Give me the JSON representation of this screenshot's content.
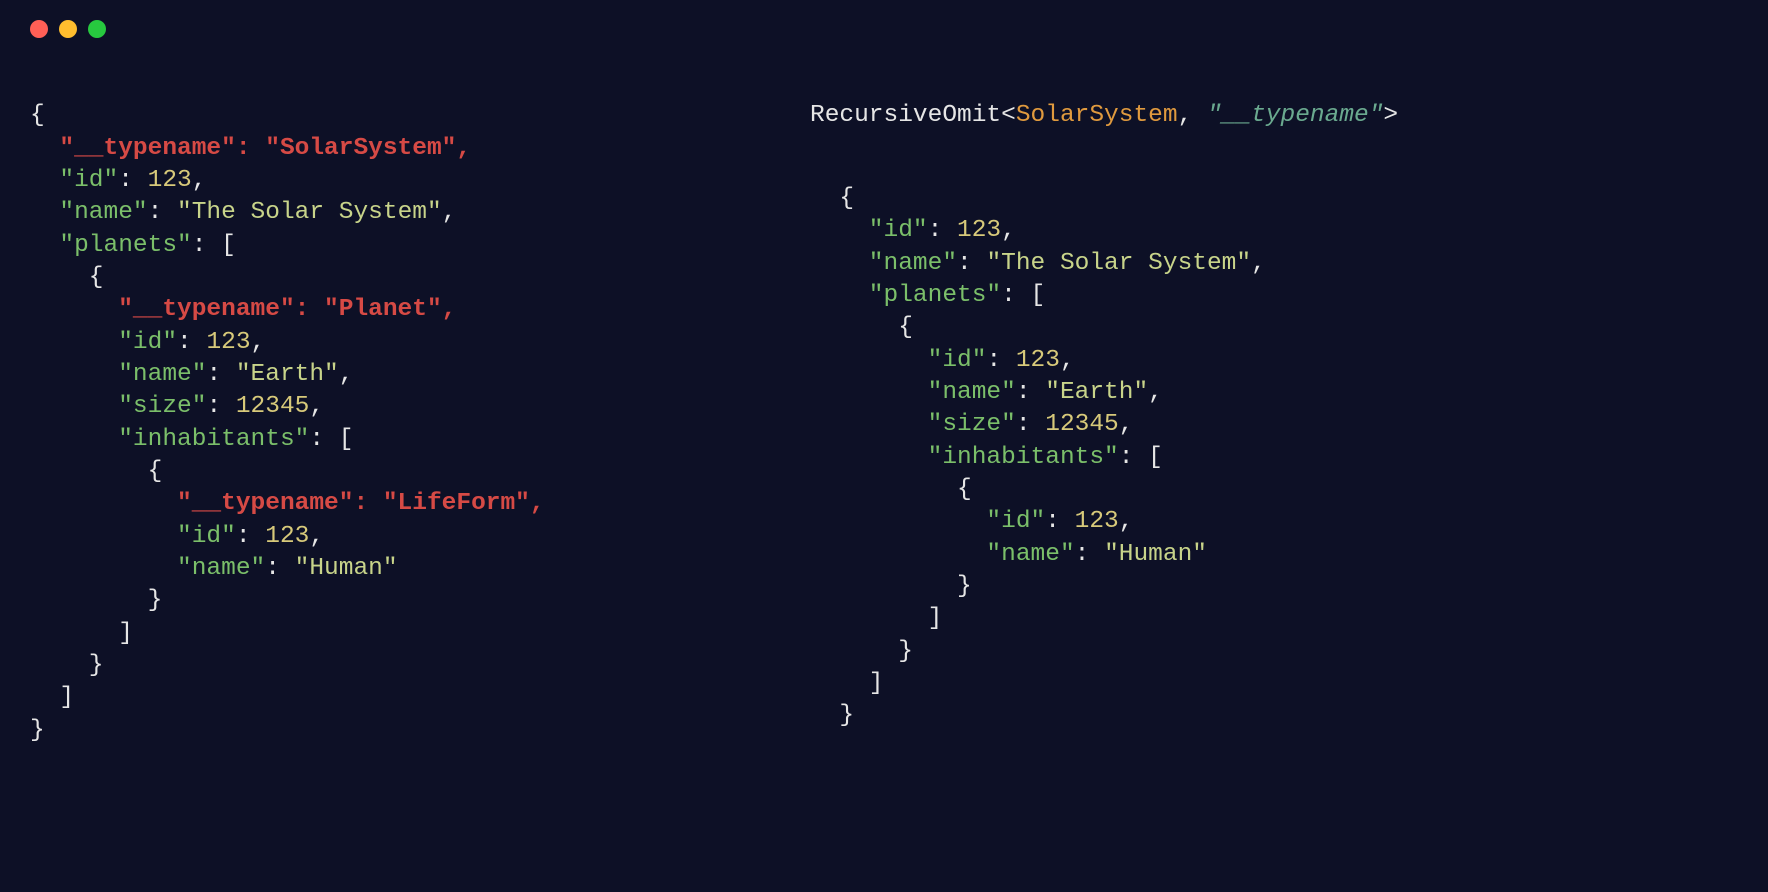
{
  "header": {
    "fn": "RecursiveOmit",
    "typeArg": "SolarSystem",
    "keyArg": "\"__typename\""
  },
  "left": {
    "l1": "{",
    "l2": "  \"__typename\": \"SolarSystem\",",
    "l3a": "  \"id\"",
    "l3b": ": ",
    "l3c": "123",
    "l3d": ",",
    "l4a": "  \"name\"",
    "l4b": ": ",
    "l4c": "\"The Solar System\"",
    "l4d": ",",
    "l5a": "  \"planets\"",
    "l5b": ": [",
    "l6": "    {",
    "l7": "      \"__typename\": \"Planet\",",
    "l8a": "      \"id\"",
    "l8b": ": ",
    "l8c": "123",
    "l8d": ",",
    "l9a": "      \"name\"",
    "l9b": ": ",
    "l9c": "\"Earth\"",
    "l9d": ",",
    "l10a": "      \"size\"",
    "l10b": ": ",
    "l10c": "12345",
    "l10d": ",",
    "l11a": "      \"inhabitants\"",
    "l11b": ": [",
    "l12": "        {",
    "l13": "          \"__typename\": \"LifeForm\",",
    "l14a": "          \"id\"",
    "l14b": ": ",
    "l14c": "123",
    "l14d": ",",
    "l15a": "          \"name\"",
    "l15b": ": ",
    "l15c": "\"Human\"",
    "l16": "        }",
    "l17": "      ]",
    "l18": "    }",
    "l19": "  ]",
    "l20": "}"
  },
  "right": {
    "r1": "  {",
    "r2a": "    \"id\"",
    "r2b": ": ",
    "r2c": "123",
    "r2d": ",",
    "r3a": "    \"name\"",
    "r3b": ": ",
    "r3c": "\"The Solar System\"",
    "r3d": ",",
    "r4a": "    \"planets\"",
    "r4b": ": [",
    "r5": "      {",
    "r6a": "        \"id\"",
    "r6b": ": ",
    "r6c": "123",
    "r6d": ",",
    "r7a": "        \"name\"",
    "r7b": ": ",
    "r7c": "\"Earth\"",
    "r7d": ",",
    "r8a": "        \"size\"",
    "r8b": ": ",
    "r8c": "12345",
    "r8d": ",",
    "r9a": "        \"inhabitants\"",
    "r9b": ": [",
    "r10": "          {",
    "r11a": "            \"id\"",
    "r11b": ": ",
    "r11c": "123",
    "r11d": ",",
    "r12a": "            \"name\"",
    "r12b": ": ",
    "r12c": "\"Human\"",
    "r13": "          }",
    "r14": "        ]",
    "r15": "      }",
    "r16": "    ]",
    "r17": "  }"
  }
}
